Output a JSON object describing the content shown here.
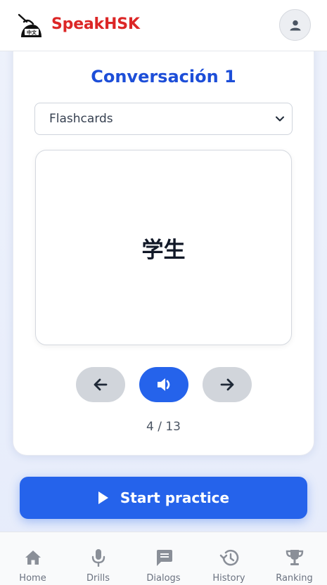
{
  "header": {
    "brand": "SpeakHSK",
    "logo_text": "中文"
  },
  "lesson": {
    "title": "Conversación 1",
    "mode_select": {
      "selected": "Flashcards"
    },
    "flashcard": {
      "text": "学生"
    },
    "counter": "4 / 13"
  },
  "start_button": {
    "label": "Start practice"
  },
  "bottom_nav": {
    "items": [
      {
        "label": "Home",
        "icon": "home-icon"
      },
      {
        "label": "Drills",
        "icon": "microphone-icon"
      },
      {
        "label": "Dialogs",
        "icon": "chat-icon"
      },
      {
        "label": "History",
        "icon": "history-icon"
      },
      {
        "label": "Ranking",
        "icon": "trophy-icon"
      }
    ]
  },
  "colors": {
    "brand": "#dc2626",
    "accent": "#2563eb",
    "title": "#1d4ed8",
    "nav_icon": "#8a8f98"
  }
}
